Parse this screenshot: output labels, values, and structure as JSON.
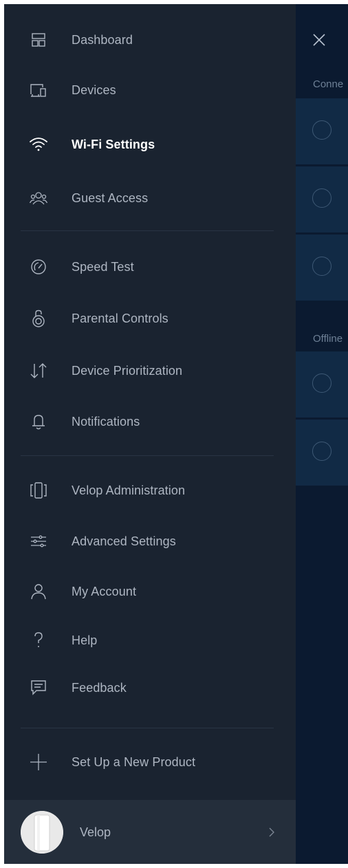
{
  "menu": {
    "items": [
      {
        "label": "Dashboard",
        "icon": "dashboard-icon"
      },
      {
        "label": "Devices",
        "icon": "devices-icon"
      },
      {
        "label": "Wi-Fi Settings",
        "icon": "wifi-icon",
        "active": true
      },
      {
        "label": "Guest Access",
        "icon": "guest-access-icon"
      },
      {
        "label": "Speed Test",
        "icon": "speedometer-icon"
      },
      {
        "label": "Parental Controls",
        "icon": "lock-icon"
      },
      {
        "label": "Device Prioritization",
        "icon": "arrows-up-down-icon"
      },
      {
        "label": "Notifications",
        "icon": "bell-icon"
      },
      {
        "label": "Velop Administration",
        "icon": "node-icon"
      },
      {
        "label": "Advanced Settings",
        "icon": "sliders-icon"
      },
      {
        "label": "My Account",
        "icon": "user-icon"
      },
      {
        "label": "Help",
        "icon": "question-icon"
      },
      {
        "label": "Feedback",
        "icon": "chat-icon"
      },
      {
        "label": "Set Up a New Product",
        "icon": "plus-icon"
      }
    ]
  },
  "footer": {
    "label": "Velop",
    "icon": "chevron-right-icon"
  },
  "background": {
    "connected_label": "Conne",
    "offline_label": "Offline"
  },
  "colors": {
    "drawer_bg": "#1a2330",
    "footer_bg": "#242e3b",
    "screen_bg": "#0b1a30",
    "row_bg": "#112a45",
    "text": "#aeb6c2",
    "active_text": "#ffffff"
  }
}
